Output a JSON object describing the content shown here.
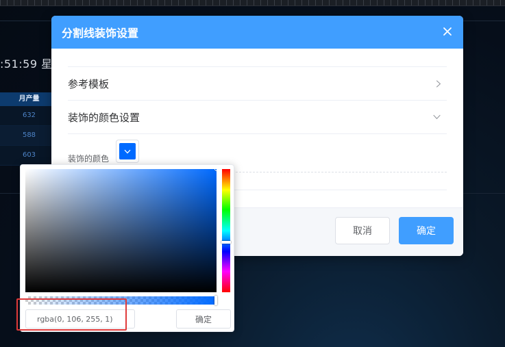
{
  "background": {
    "clock_text": ":51:59 星期",
    "table": {
      "header": "月产量",
      "rows": [
        "632",
        "588",
        "603"
      ]
    }
  },
  "dialog": {
    "title": "分割线装饰设置",
    "close_icon": "close-icon",
    "sections": [
      {
        "label": "参考模板",
        "icon": "chevron-right-icon",
        "expanded": false
      },
      {
        "label": "装饰的颜色设置",
        "icon": "chevron-down-icon",
        "expanded": true
      }
    ],
    "color_field_label": "装饰的颜色",
    "color_value": "#006aff",
    "cancel_label": "取消",
    "confirm_label": "确定"
  },
  "picker": {
    "hue_color": "#006aff",
    "value": "rgba(0, 106, 255, 1)",
    "confirm_label": "确定",
    "saturation": 1.0,
    "brightness": 1.0,
    "hue_fraction": 0.597,
    "alpha": 1
  },
  "colors": {
    "accent": "#409eff",
    "annotation": "#e03a3a"
  }
}
